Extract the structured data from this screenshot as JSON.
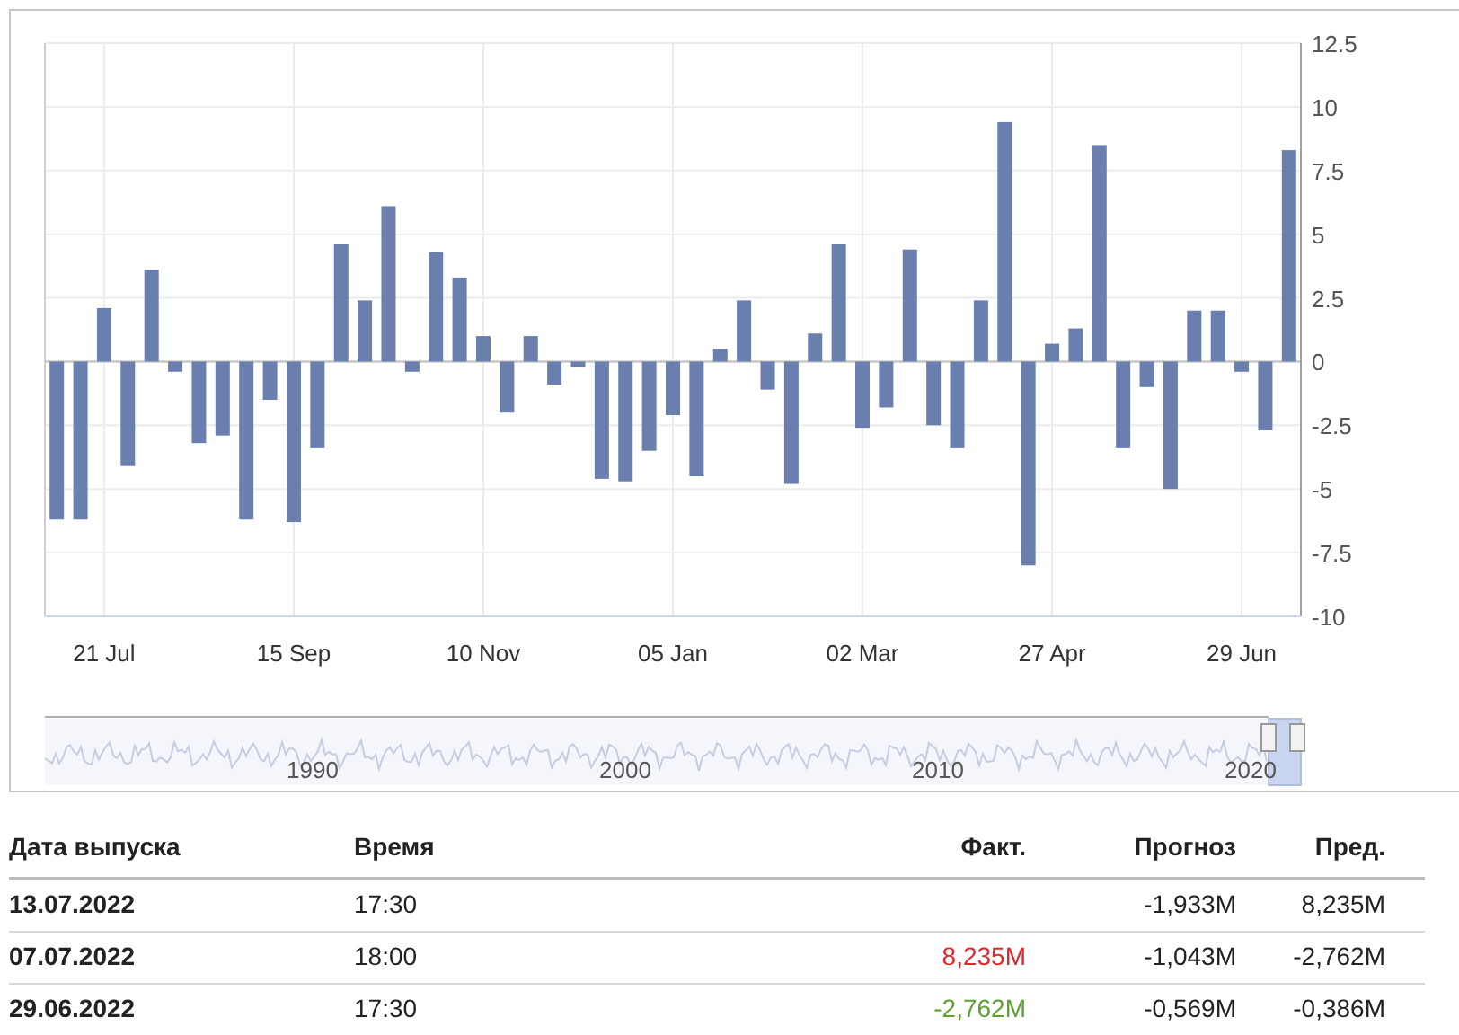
{
  "chart": {
    "chart_data": {
      "type": "bar",
      "grid": true,
      "categories": [
        null,
        null,
        "21 Jul",
        null,
        null,
        null,
        null,
        null,
        null,
        null,
        "15 Sep",
        null,
        null,
        null,
        null,
        null,
        null,
        null,
        "10 Nov",
        null,
        null,
        null,
        null,
        null,
        null,
        null,
        "05 Jan",
        null,
        null,
        null,
        null,
        null,
        null,
        null,
        "02 Mar",
        null,
        null,
        null,
        null,
        null,
        null,
        null,
        "27 Apr",
        null,
        null,
        null,
        null,
        null,
        null,
        null,
        "29 Jun",
        null,
        null
      ],
      "series": [
        {
          "color": "#6a7fad",
          "values": [
            -6.2,
            -6.2,
            2.1,
            -4.1,
            3.6,
            -0.4,
            -3.2,
            -2.9,
            -6.2,
            -1.5,
            -6.3,
            -3.4,
            4.6,
            2.4,
            6.1,
            -0.4,
            4.3,
            3.3,
            1.0,
            -2.0,
            1.0,
            -0.9,
            -0.2,
            -4.6,
            -4.7,
            -3.5,
            -2.1,
            -4.5,
            0.5,
            2.4,
            -1.1,
            -4.8,
            1.1,
            4.6,
            -2.6,
            -1.8,
            4.4,
            -2.5,
            -3.4,
            2.4,
            9.4,
            -8.0,
            0.7,
            1.3,
            8.5,
            -3.4,
            -1.0,
            -5.0,
            2.0,
            2.0,
            -0.4,
            -2.7,
            8.3
          ]
        }
      ],
      "ylim": [
        -10,
        12.5
      ],
      "yticks": [
        {
          "value": 12.5,
          "label": "12.5"
        },
        {
          "value": 10,
          "label": "10"
        },
        {
          "value": 7.5,
          "label": "7.5"
        },
        {
          "value": 5,
          "label": "5"
        },
        {
          "value": 2.5,
          "label": "2.5"
        },
        {
          "value": 0,
          "label": "0"
        },
        {
          "value": -2.5,
          "label": "-2.5"
        },
        {
          "value": -5,
          "label": "-5"
        },
        {
          "value": -7.5,
          "label": "-7.5"
        },
        {
          "value": -10,
          "label": "-10"
        }
      ]
    },
    "navigator": {
      "labels": [
        "1990",
        "2000",
        "2010",
        "2020"
      ]
    }
  },
  "table": {
    "columns": [
      "Дата выпуска",
      "Время",
      "Факт.",
      "Прогноз",
      "Пред."
    ],
    "rows": [
      {
        "date": "13.07.2022",
        "time": "17:30",
        "forecast": "-1,933M",
        "previous": "8,235M"
      },
      {
        "date": "07.07.2022",
        "time": "18:00",
        "actual": {
          "text": "8,235M",
          "color": "#e0262b"
        },
        "forecast": "-1,043M",
        "previous": "-2,762M"
      },
      {
        "date": "29.06.2022",
        "time": "17:30",
        "actual": {
          "text": "-2,762M",
          "color": "#5ba22f"
        },
        "forecast": "-0,569M",
        "previous": "-0,386M"
      }
    ]
  }
}
